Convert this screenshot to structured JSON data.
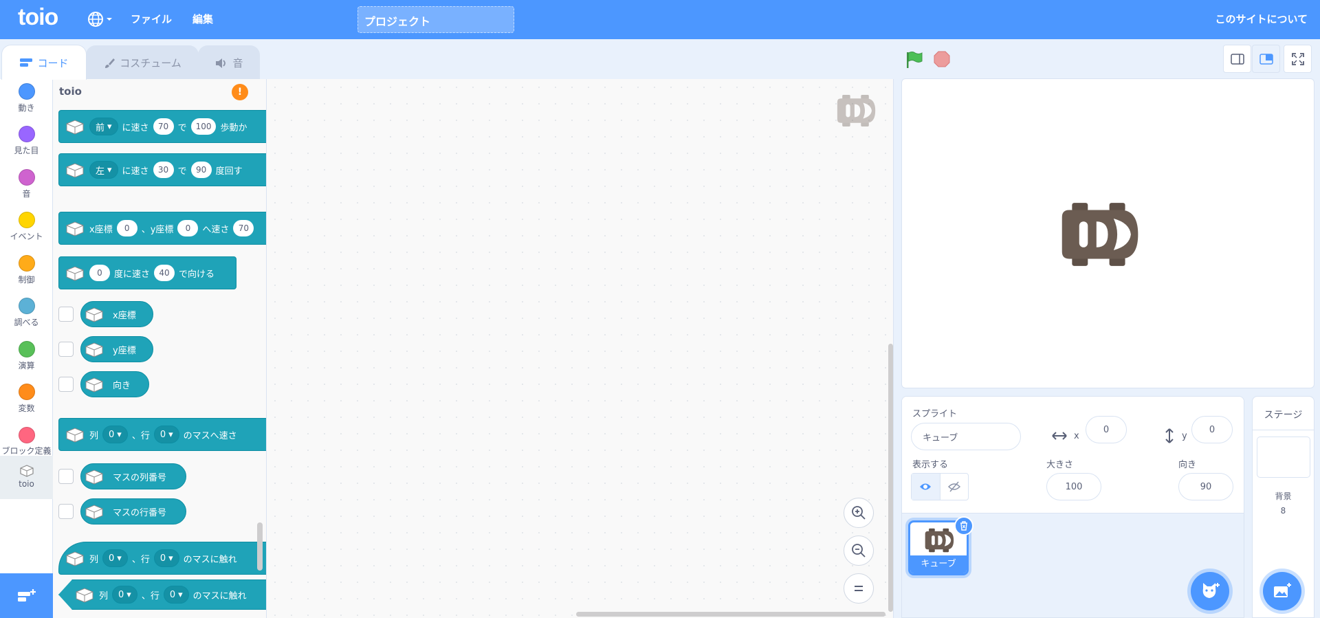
{
  "menubar": {
    "logo": "toio",
    "file": "ファイル",
    "edit": "編集",
    "project_title": "プロジェクト",
    "about": "このサイトについて"
  },
  "tabs": {
    "code": "コード",
    "costumes": "コスチューム",
    "sounds": "音"
  },
  "categories": [
    {
      "label": "動き",
      "color": "#4c97ff"
    },
    {
      "label": "見た目",
      "color": "#9966ff"
    },
    {
      "label": "音",
      "color": "#cf63cf"
    },
    {
      "label": "イベント",
      "color": "#ffd500"
    },
    {
      "label": "制御",
      "color": "#ffab19"
    },
    {
      "label": "調べる",
      "color": "#5cb1d6"
    },
    {
      "label": "演算",
      "color": "#59c059"
    },
    {
      "label": "変数",
      "color": "#ff8c1a"
    },
    {
      "label": "ブロック定義",
      "color": "#ff6680"
    },
    {
      "label": "toio",
      "color": ""
    }
  ],
  "palette": {
    "heading": "toio",
    "move_dir": "前",
    "speed_text": "に速さ",
    "de": "で",
    "move_speed": "70",
    "move_steps": "100",
    "move_tail": "歩動か",
    "turn_dir": "左",
    "turn_speed": "30",
    "turn_deg": "90",
    "turn_tail": "度回す",
    "xy_x_label": "x座標",
    "xy_x": "0",
    "xy_sep": "、y座標",
    "xy_y": "0",
    "xy_tail": "へ速さ",
    "xy_speed": "70",
    "point_deg": "0",
    "point_text": "度に速さ",
    "point_speed": "40",
    "point_tail": "で向ける",
    "rep_x": "x座標",
    "rep_y": "y座標",
    "rep_dir": "向き",
    "grid_col": "列",
    "grid_col_val": "0",
    "grid_row": "、行",
    "grid_row_val": "0",
    "grid_move_tail": "のマスへ速さ",
    "rep_col_num": "マスの列番号",
    "rep_row_num": "マスの行番号",
    "grid_touch_tail": "のマスに触れ",
    "grid_touch2_tail": "のマスに触れ"
  },
  "sprite_info": {
    "sprite_label": "スプライト",
    "sprite_name": "キューブ",
    "x_label": "x",
    "x": "0",
    "y_label": "y",
    "y": "0",
    "show_label": "表示する",
    "size_label": "大きさ",
    "size": "100",
    "direction_label": "向き",
    "direction": "90"
  },
  "sprite_list": [
    {
      "name": "キューブ",
      "selected": true
    }
  ],
  "stage_pane": {
    "title": "ステージ",
    "backdrops_label": "背景",
    "backdrops_count": "8"
  },
  "colors": {
    "accent": "#4c97ff",
    "toio_block": "#1fa3b8",
    "stop": "#ec9c9c",
    "flag": "#4cbf56",
    "warning": "#ff8c1a"
  }
}
